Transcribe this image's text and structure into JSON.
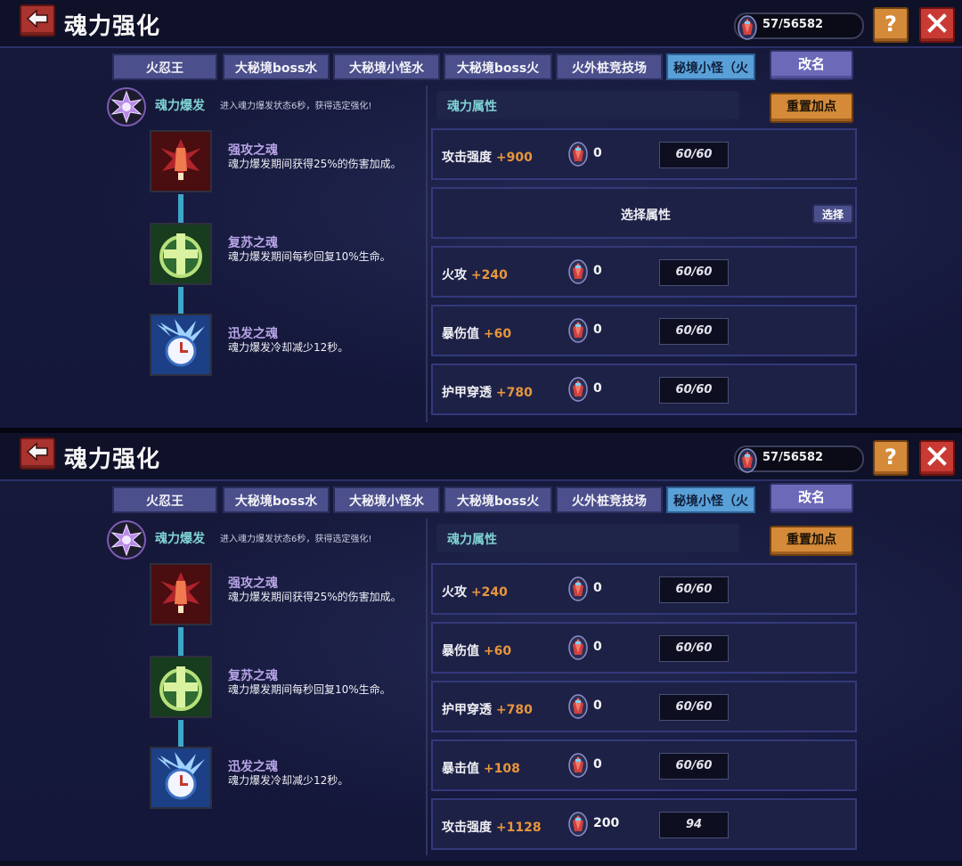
{
  "screen_title": "魂力强化",
  "currency": {
    "icon": "soul-gem-icon",
    "value": "57/56582"
  },
  "header_buttons": {
    "help": "?",
    "close_icon": "close-icon",
    "back_icon": "back-arrow-icon"
  },
  "tabs": [
    "火忍王",
    "大秘境boss水",
    "大秘境小怪水",
    "大秘境boss火",
    "火外桩竞技场",
    "秘境小怪（火"
  ],
  "rename_label": "改名",
  "burst": {
    "label": "魂力爆发",
    "desc": "进入魂力爆发状态6秒，获得选定强化!"
  },
  "skills": [
    {
      "name": "强攻之魂",
      "desc": "魂力爆发期间获得25%的伤害加成。",
      "icon": "red-power-icon"
    },
    {
      "name": "复苏之魂",
      "desc": "魂力爆发期间每秒回复10%生命。",
      "icon": "green-heal-icon"
    },
    {
      "name": "迅发之魂",
      "desc": "魂力爆发冷却减少12秒。",
      "icon": "blue-clock-icon"
    }
  ],
  "attr_title": "魂力属性",
  "reset_label": "重置加点",
  "panels": [
    {
      "rows": [
        {
          "type": "attr",
          "name": "攻击强度",
          "bonus": "+900",
          "points": "0",
          "progress": "60/60"
        },
        {
          "type": "select",
          "label": "选择属性",
          "button": "选择"
        },
        {
          "type": "attr",
          "name": "火攻",
          "bonus": "+240",
          "points": "0",
          "progress": "60/60"
        },
        {
          "type": "attr",
          "name": "暴伤值",
          "bonus": "+60",
          "points": "0",
          "progress": "60/60"
        },
        {
          "type": "attr",
          "name": "护甲穿透",
          "bonus": "+780",
          "points": "0",
          "progress": "60/60"
        }
      ]
    },
    {
      "rows": [
        {
          "type": "attr",
          "name": "火攻",
          "bonus": "+240",
          "points": "0",
          "progress": "60/60"
        },
        {
          "type": "attr",
          "name": "暴伤值",
          "bonus": "+60",
          "points": "0",
          "progress": "60/60"
        },
        {
          "type": "attr",
          "name": "护甲穿透",
          "bonus": "+780",
          "points": "0",
          "progress": "60/60"
        },
        {
          "type": "attr",
          "name": "暴击值",
          "bonus": "+108",
          "points": "0",
          "progress": "60/60"
        },
        {
          "type": "attr",
          "name": "攻击强度",
          "bonus": "+1128",
          "points": "200",
          "progress": "94"
        }
      ]
    }
  ]
}
